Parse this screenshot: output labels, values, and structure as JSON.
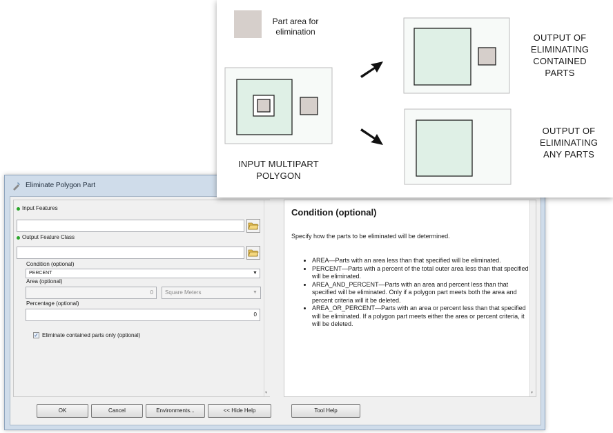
{
  "dialog": {
    "title": "Eliminate Polygon Part",
    "fields": {
      "input_features_label": "Input Features",
      "output_feature_class_label": "Output Feature Class",
      "condition_label": "Condition (optional)",
      "condition_value": "PERCENT",
      "area_label": "Area (optional)",
      "area_value": "0",
      "area_unit": "Square Meters",
      "percentage_label": "Percentage (optional)",
      "percentage_value": "0",
      "eliminate_contained_label": "Eliminate contained parts only (optional)",
      "eliminate_contained_checked": true
    },
    "help": {
      "title": "Condition (optional)",
      "description": "Specify how the parts to be eliminated will be determined.",
      "items": [
        "AREA—Parts with an area less than that specified will be eliminated.",
        "PERCENT—Parts with a percent of the total outer area less than that specified will be eliminated.",
        "AREA_AND_PERCENT—Parts with an area and percent less than that specified will be eliminated. Only if a polygon part meets both the area and percent criteria will it be deleted.",
        "AREA_OR_PERCENT—Parts with an area or percent less than that specified will be eliminated. If a polygon part meets either the area or percent criteria, it will be deleted."
      ]
    },
    "buttons": {
      "ok": "OK",
      "cancel": "Cancel",
      "environments": "Environments...",
      "hide_help": "<< Hide Help",
      "tool_help": "Tool Help"
    }
  },
  "diagram": {
    "legend": "Part area for elimination",
    "input_label": "INPUT MULTIPART POLYGON",
    "output_contained_label": "OUTPUT OF ELIMINATING CONTAINED PARTS",
    "output_any_label": "OUTPUT OF ELIMINATING ANY PARTS",
    "colors": {
      "elimination_fill": "#d6cfcb",
      "polygon_fill": "#dff0e6",
      "panel_bg": "#f7faf8"
    }
  }
}
